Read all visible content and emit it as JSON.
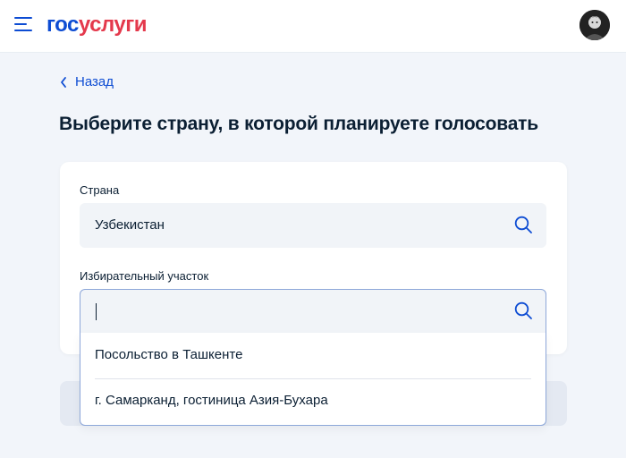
{
  "header": {
    "logo_part1": "гос",
    "logo_part2": "услуги",
    "menu_icon": "menu-icon",
    "avatar": "user-avatar"
  },
  "nav": {
    "back_label": "Назад"
  },
  "page": {
    "title": "Выберите страну, в которой планируете голосовать"
  },
  "form": {
    "country": {
      "label": "Страна",
      "value": "Узбекистан",
      "icon": "search-icon"
    },
    "polling_station": {
      "label": "Избирательный участок",
      "value": "",
      "icon": "search-icon",
      "options": [
        "Посольство в Ташкенте",
        "г. Самарканд, гостиница Азия-Бухара"
      ]
    }
  },
  "colors": {
    "brand_blue": "#0d4cd3",
    "brand_red": "#e4394c",
    "text": "#0b1f33",
    "background": "#f2f5fa"
  }
}
